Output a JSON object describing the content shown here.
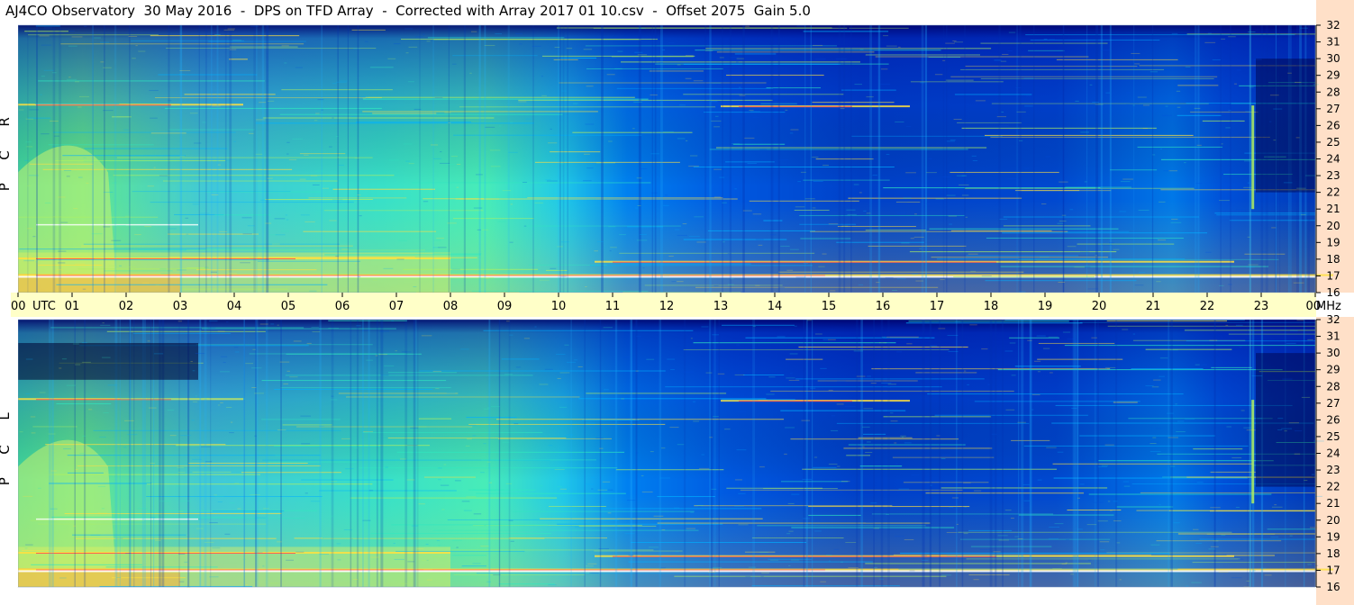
{
  "title": "AJ4CO Observatory  30 May 2016  -  DPS on TFD Array  -  Corrected with Array 2017 01 10.csv  -  Offset 2075  Gain 5.0",
  "colors": {
    "time_bar": "#ffffc8",
    "right_margin": "#ffe0c8",
    "colormap": [
      "#00004a",
      "#0000a0",
      "#0050e0",
      "#00b0ff",
      "#30e8c0",
      "#b0f060",
      "#ffe040",
      "#ff7020",
      "#d00010"
    ]
  },
  "chart_data": {
    "type": "heatmap",
    "title": "AJ4CO Observatory  30 May 2016  -  DPS on TFD Array  -  Corrected with Array 2017 01 10.csv  -  Offset 2075  Gain 5.0",
    "x_axis": {
      "label": "UTC",
      "ticks": [
        "00",
        "01",
        "02",
        "03",
        "04",
        "05",
        "06",
        "07",
        "08",
        "09",
        "10",
        "11",
        "12",
        "13",
        "14",
        "15",
        "16",
        "17",
        "18",
        "19",
        "20",
        "21",
        "22",
        "23",
        "00"
      ],
      "range_hours": [
        0,
        24
      ]
    },
    "y_axis": {
      "unit": "MHz",
      "ticks": [
        32,
        31,
        30,
        29,
        28,
        27,
        26,
        25,
        24,
        23,
        22,
        21,
        20,
        19,
        18,
        17,
        16
      ],
      "range_mhz": [
        16,
        32
      ]
    },
    "panels": [
      {
        "name": "RCP",
        "letters": [
          "R",
          "C",
          "P"
        ]
      },
      {
        "name": "LCP",
        "letters": [
          "L",
          "C",
          "P"
        ]
      }
    ]
  }
}
